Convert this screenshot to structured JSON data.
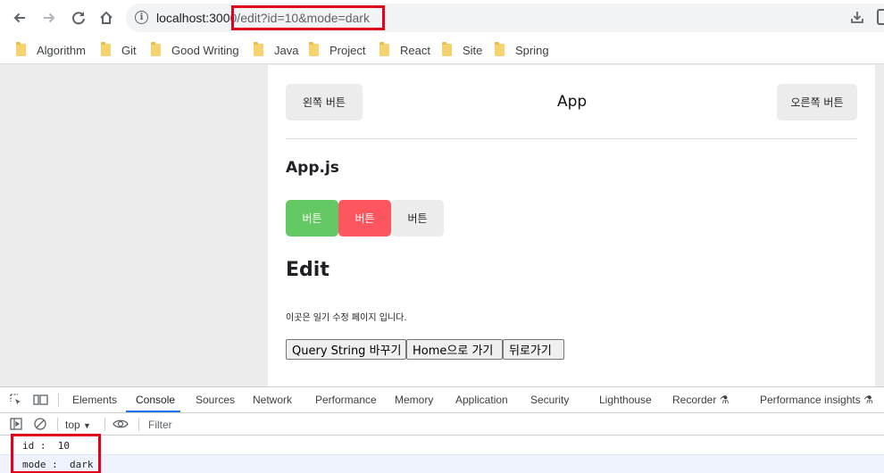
{
  "browser": {
    "url_host": "localhost:300",
    "url_path": "0/edit?id=10&mode=dark",
    "bookmarks": [
      "Algorithm",
      "Git",
      "Good Writing",
      "Java",
      "Project",
      "React",
      "Site",
      "Spring"
    ]
  },
  "page": {
    "header": {
      "left_button": "왼쪽 버튼",
      "title": "App",
      "right_button": "오른쪽 버튼"
    },
    "appjs_heading": "App.js",
    "buttons": [
      {
        "label": "버튼",
        "bg": "#64c964",
        "color": "#ffffff"
      },
      {
        "label": "버튼",
        "bg": "#fd565f",
        "color": "#ffffff"
      },
      {
        "label": "버튼",
        "bg": "#ececec",
        "color": "#222222"
      }
    ],
    "edit_heading": "Edit",
    "description": "이곳은 일기 수정 페이지 입니다.",
    "action_buttons": [
      "Query String 바꾸기",
      "Home으로 가기",
      "뒤로가기"
    ]
  },
  "devtools": {
    "tabs": [
      "Elements",
      "Console",
      "Sources",
      "Network",
      "Performance",
      "Memory",
      "Application",
      "Security",
      "Lighthouse",
      "Recorder",
      "Performance insights"
    ],
    "active_tab": "Console",
    "context": "top",
    "filter_placeholder": "Filter",
    "logs": [
      {
        "text": "id :  10"
      },
      {
        "text": "mode :  dark"
      }
    ]
  },
  "colors": {
    "highlight": "#e4001b",
    "active_tab_underline": "#1a73e8"
  }
}
